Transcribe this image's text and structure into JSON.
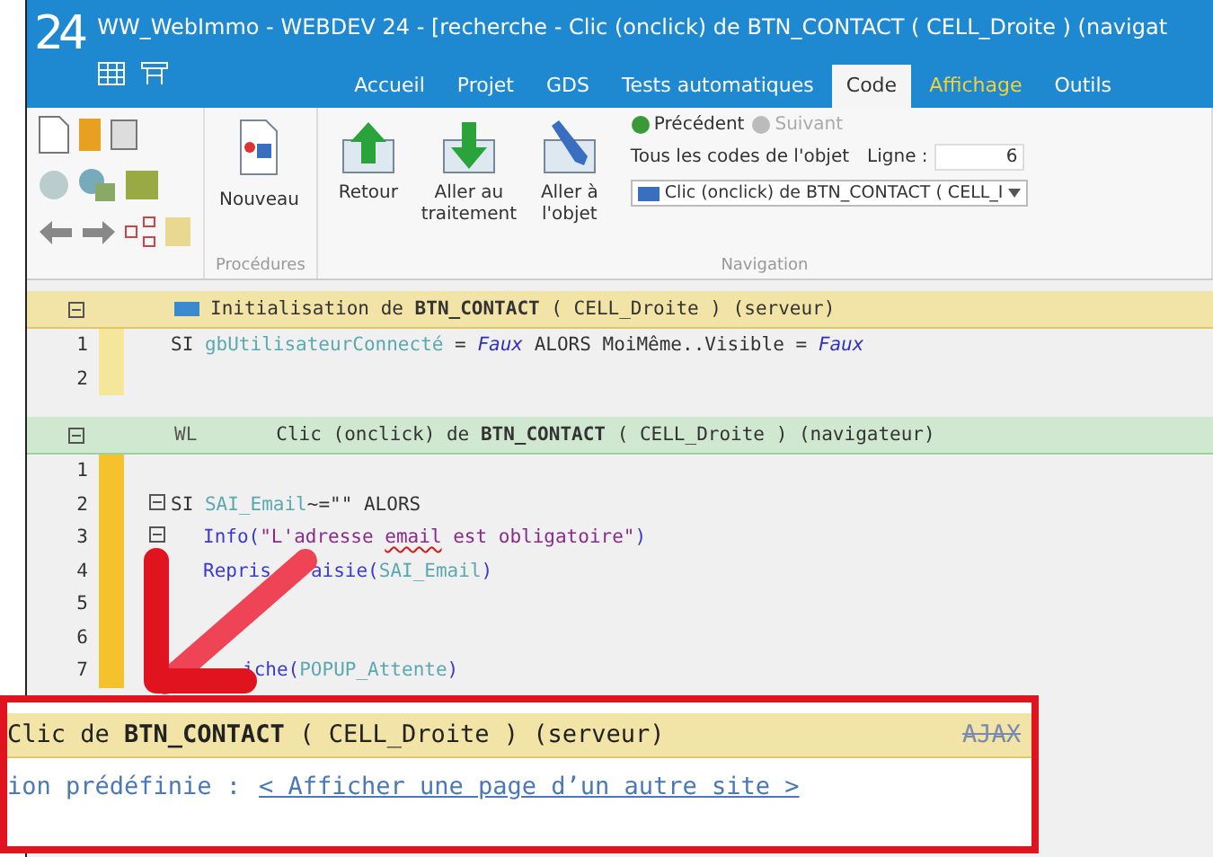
{
  "window": {
    "logo": "24",
    "title": "WW_WebImmo - WEBDEV 24 - [recherche - Clic (onclick) de BTN_CONTACT ( CELL_Droite ) (navigat"
  },
  "tabs": [
    {
      "label": "Accueil",
      "selected": false,
      "highlighted": false
    },
    {
      "label": "Projet",
      "selected": false,
      "highlighted": false
    },
    {
      "label": "GDS",
      "selected": false,
      "highlighted": false
    },
    {
      "label": "Tests automatiques",
      "selected": false,
      "highlighted": false
    },
    {
      "label": "Code",
      "selected": true,
      "highlighted": false
    },
    {
      "label": "Affichage",
      "selected": false,
      "highlighted": true
    },
    {
      "label": "Outils",
      "selected": false,
      "highlighted": false
    }
  ],
  "ribbon": {
    "procedures": {
      "label": "Procédures",
      "new_button": "Nouveau"
    },
    "navigation": {
      "label": "Navigation",
      "buttons": [
        {
          "label": "Retour",
          "kind": "up"
        },
        {
          "label": "Aller au traitement",
          "kind": "down"
        },
        {
          "label": "Aller à l'objet",
          "kind": "pen"
        }
      ],
      "previous": {
        "label": "Précédent",
        "disabled": false
      },
      "next": {
        "label": "Suivant",
        "disabled": true
      },
      "all_codes": "Tous les codes de l'objet",
      "line_label": "Ligne :",
      "line_value": "6",
      "event_select": "Clic (onclick) de BTN_CONTACT ( CELL_I"
    }
  },
  "code_sections": [
    {
      "kind": "server",
      "header": "Initialisation de **BTN_CONTACT** ( CELL_Droite ) (serveur)",
      "lines": [
        {
          "number": "1",
          "fold": false,
          "indented": false,
          "tokens": [
            {
              "text": "SI ",
              "kind": "kw"
            },
            {
              "text": "gbUtilisateurConnecté",
              "kind": "var"
            },
            {
              "text": " = ",
              "kind": "kw"
            },
            {
              "text": "Faux",
              "kind": "const"
            },
            {
              "text": " ALORS MoiMême..Visible = ",
              "kind": "kw"
            },
            {
              "text": "Faux",
              "kind": "const"
            }
          ]
        },
        {
          "number": "2",
          "fold": false
        }
      ]
    },
    {
      "kind": "browser",
      "prefix": "WL",
      "header": "Clic (onclick) de **BTN_CONTACT** ( CELL_Droite ) (navigateur)",
      "lines": [
        {
          "number": "1",
          "fold": false
        },
        {
          "number": "2",
          "fold": true,
          "indented": false,
          "tokens": [
            {
              "text": "SI ",
              "kind": "kw"
            },
            {
              "text": "SAI_Email",
              "kind": "var"
            },
            {
              "text": "~=\"\" ALORS",
              "kind": "kw"
            }
          ]
        },
        {
          "number": "3",
          "fold": true,
          "indented": true,
          "tokens": [
            {
              "text": "Info(",
              "kind": "func"
            },
            {
              "text": "\"L'adresse ",
              "kind": "str"
            },
            {
              "text": "email",
              "kind": "misspelled"
            },
            {
              "text": " est obligatoire\"",
              "kind": "str"
            },
            {
              "text": ")",
              "kind": "func"
            }
          ]
        },
        {
          "number": "4",
          "fold": false,
          "indented": true,
          "tokens": [
            {
              "text": "Repris",
              "kind": "func"
            },
            {
              "text": "aisie(",
              "kind": "func",
              "gap_before": true
            },
            {
              "text": "SAI_Email",
              "kind": "var"
            },
            {
              "text": ")",
              "kind": "func"
            }
          ]
        },
        {
          "number": "5",
          "fold": false
        },
        {
          "number": "6",
          "fold": false
        },
        {
          "number": "7",
          "fold": false,
          "indented": true,
          "tokens": [
            {
              "text": "iche(",
              "kind": "func",
              "gap_before": true
            },
            {
              "text": "POPUP_Attente",
              "kind": "var"
            },
            {
              "text": ")",
              "kind": "func"
            }
          ]
        }
      ]
    }
  ],
  "callout": {
    "header": "Clic de **BTN_CONTACT** ( CELL_Droite ) (serveur)",
    "ajax": {
      "label": "AJAX",
      "struck": true
    },
    "predefined_label": "ion prédéfinie :",
    "link": "< Afficher une page d’un autre site >"
  }
}
